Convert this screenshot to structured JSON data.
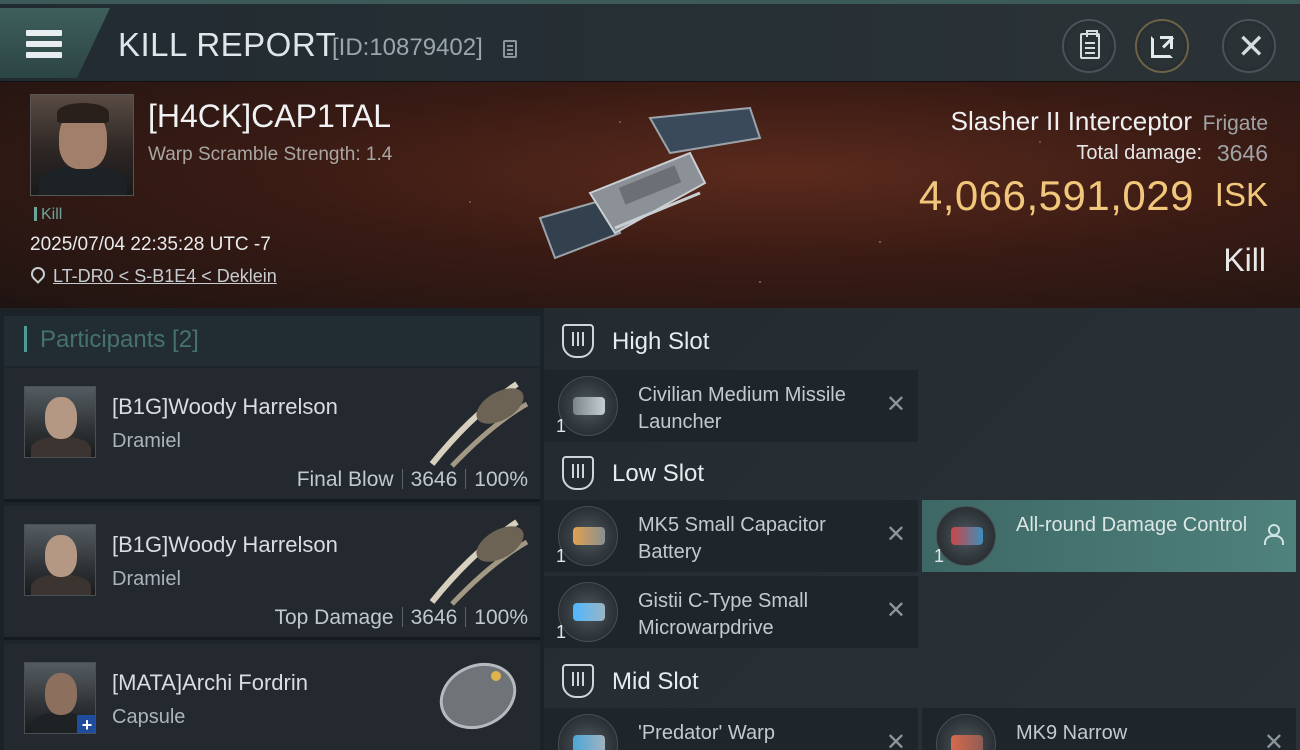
{
  "header": {
    "title": "KILL REPORT",
    "id_text": "[ID:10879402]"
  },
  "victim": {
    "name": "[H4CK]CAP1TAL",
    "scramble": "Warp Scramble Strength: 1.4",
    "tag": "Kill",
    "datetime": "2025/07/04 22:35:28 UTC -7",
    "location": "LT-DR0 < S-B1E4 < Deklein"
  },
  "ship": {
    "name": "Slasher II Interceptor",
    "class": "Frigate",
    "damage_label": "Total damage:",
    "damage_value": "3646",
    "isk_value": "4,066,591,029",
    "isk_label": "ISK",
    "kill_type": "Kill"
  },
  "participants": {
    "title": "Participants [2]",
    "rows": [
      {
        "name": "[B1G]Woody Harrelson",
        "ship": "Dramiel",
        "role": "Final Blow",
        "damage": "3646",
        "percent": "100%"
      },
      {
        "name": "[B1G]Woody Harrelson",
        "ship": "Dramiel",
        "role": "Top Damage",
        "damage": "3646",
        "percent": "100%"
      },
      {
        "name": "[MATA]Archi Fordrin",
        "ship": "Capsule",
        "role": "",
        "damage": "",
        "percent": ""
      }
    ]
  },
  "fitting": {
    "high_slot": {
      "title": "High Slot",
      "modules": [
        {
          "qty": "1",
          "name": "Civilian Medium Missile Launcher",
          "icon": "missile-launcher-icon"
        }
      ]
    },
    "low_slot": {
      "title": "Low Slot",
      "modules": [
        {
          "qty": "1",
          "name": "MK5 Small Capacitor Battery",
          "icon": "capacitor-battery-icon"
        },
        {
          "qty": "1",
          "name": "All-round Damage Control",
          "icon": "damage-control-icon",
          "dropped": true
        },
        {
          "qty": "1",
          "name": "Gistii C-Type Small Microwarpdrive",
          "icon": "microwarpdrive-icon"
        }
      ]
    },
    "mid_slot": {
      "title": "Mid Slot",
      "modules": [
        {
          "qty": "",
          "name": "'Predator' Warp",
          "icon": "warp-disruptor-icon"
        },
        {
          "qty": "",
          "name": "MK9 Narrow",
          "icon": "module-icon"
        }
      ]
    }
  },
  "colors": {
    "accent_teal": "#4f9a96",
    "isk_gold": "#f1c77c",
    "dropped_module": "#4f817d"
  }
}
